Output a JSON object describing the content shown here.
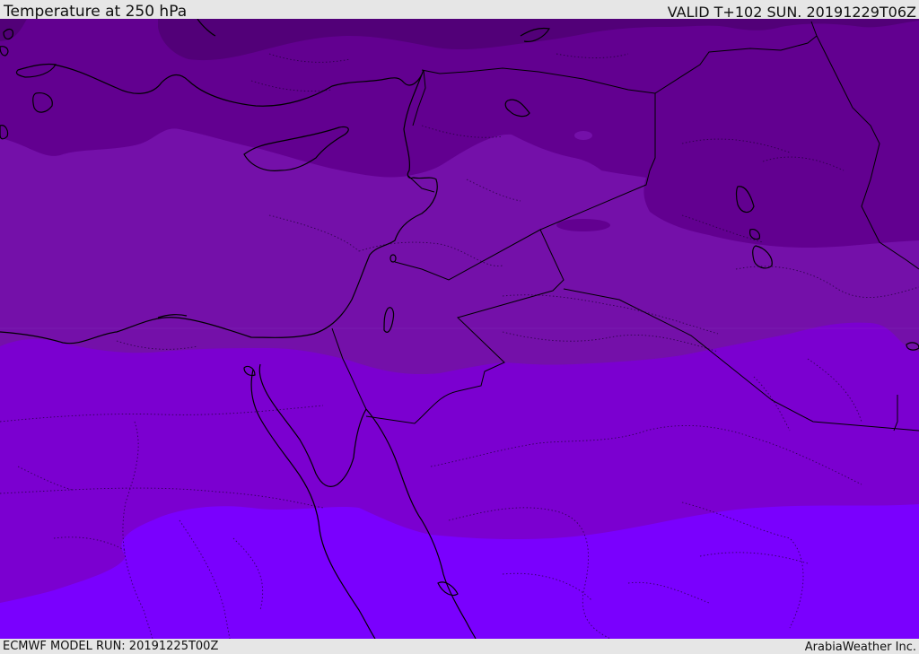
{
  "header": {
    "title": "Temperature at 250 hPa",
    "valid": "VALID T+102 SUN. 20191229T06Z"
  },
  "footer": {
    "model_run": "ECMWF MODEL RUN: 20191225T00Z",
    "credit": "ArabiaWeather Inc."
  },
  "map": {
    "colors": {
      "band1": "#520078",
      "band2": "#620090",
      "band3": "#7410a9",
      "band4": "#7b00d0",
      "band5": "#7a00fe",
      "lines": "#000000"
    }
  }
}
